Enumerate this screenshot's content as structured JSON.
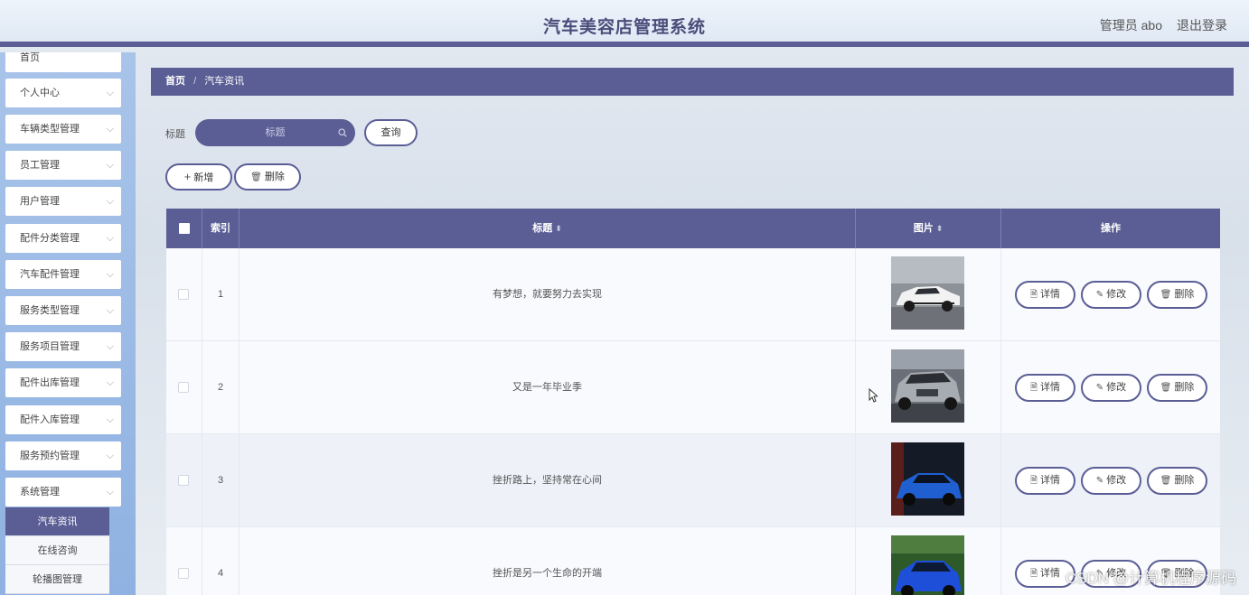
{
  "header": {
    "title": "汽车美容店管理系统",
    "user": "管理员 abo",
    "logout": "退出登录"
  },
  "sidebar": {
    "top_item": "首页",
    "items": [
      {
        "label": "个人中心"
      },
      {
        "label": "车辆类型管理"
      },
      {
        "label": "员工管理"
      },
      {
        "label": "用户管理"
      },
      {
        "label": "配件分类管理"
      },
      {
        "label": "汽车配件管理"
      },
      {
        "label": "服务类型管理"
      },
      {
        "label": "服务项目管理"
      },
      {
        "label": "配件出库管理"
      },
      {
        "label": "配件入库管理"
      },
      {
        "label": "服务预约管理"
      },
      {
        "label": "系统管理"
      }
    ],
    "submenu": [
      {
        "label": "汽车资讯",
        "active": true
      },
      {
        "label": "在线咨询",
        "active": false
      },
      {
        "label": "轮播图管理",
        "active": false
      }
    ]
  },
  "breadcrumb": {
    "home": "首页",
    "separator": "/",
    "current": "汽车资讯"
  },
  "search": {
    "label": "标题",
    "placeholder": "标题",
    "button": "查询"
  },
  "toolbar": {
    "add": "新增",
    "delete": "删除"
  },
  "table": {
    "headers": {
      "index": "索引",
      "title": "标题",
      "image": "图片",
      "actions": "操作"
    },
    "rows": [
      {
        "index": "1",
        "title": "有梦想，就要努力去实现"
      },
      {
        "index": "2",
        "title": "又是一年毕业季"
      },
      {
        "index": "3",
        "title": "挫折路上，坚持常在心间"
      },
      {
        "index": "4",
        "title": "挫折是另一个生命的开端"
      }
    ],
    "actions": {
      "detail": "详情",
      "edit": "修改",
      "delete": "删除"
    }
  },
  "watermark": "CSDN @计算机程序源码",
  "colors": {
    "accent": "#5b5e95",
    "sidebar": "#a9c4e9"
  }
}
